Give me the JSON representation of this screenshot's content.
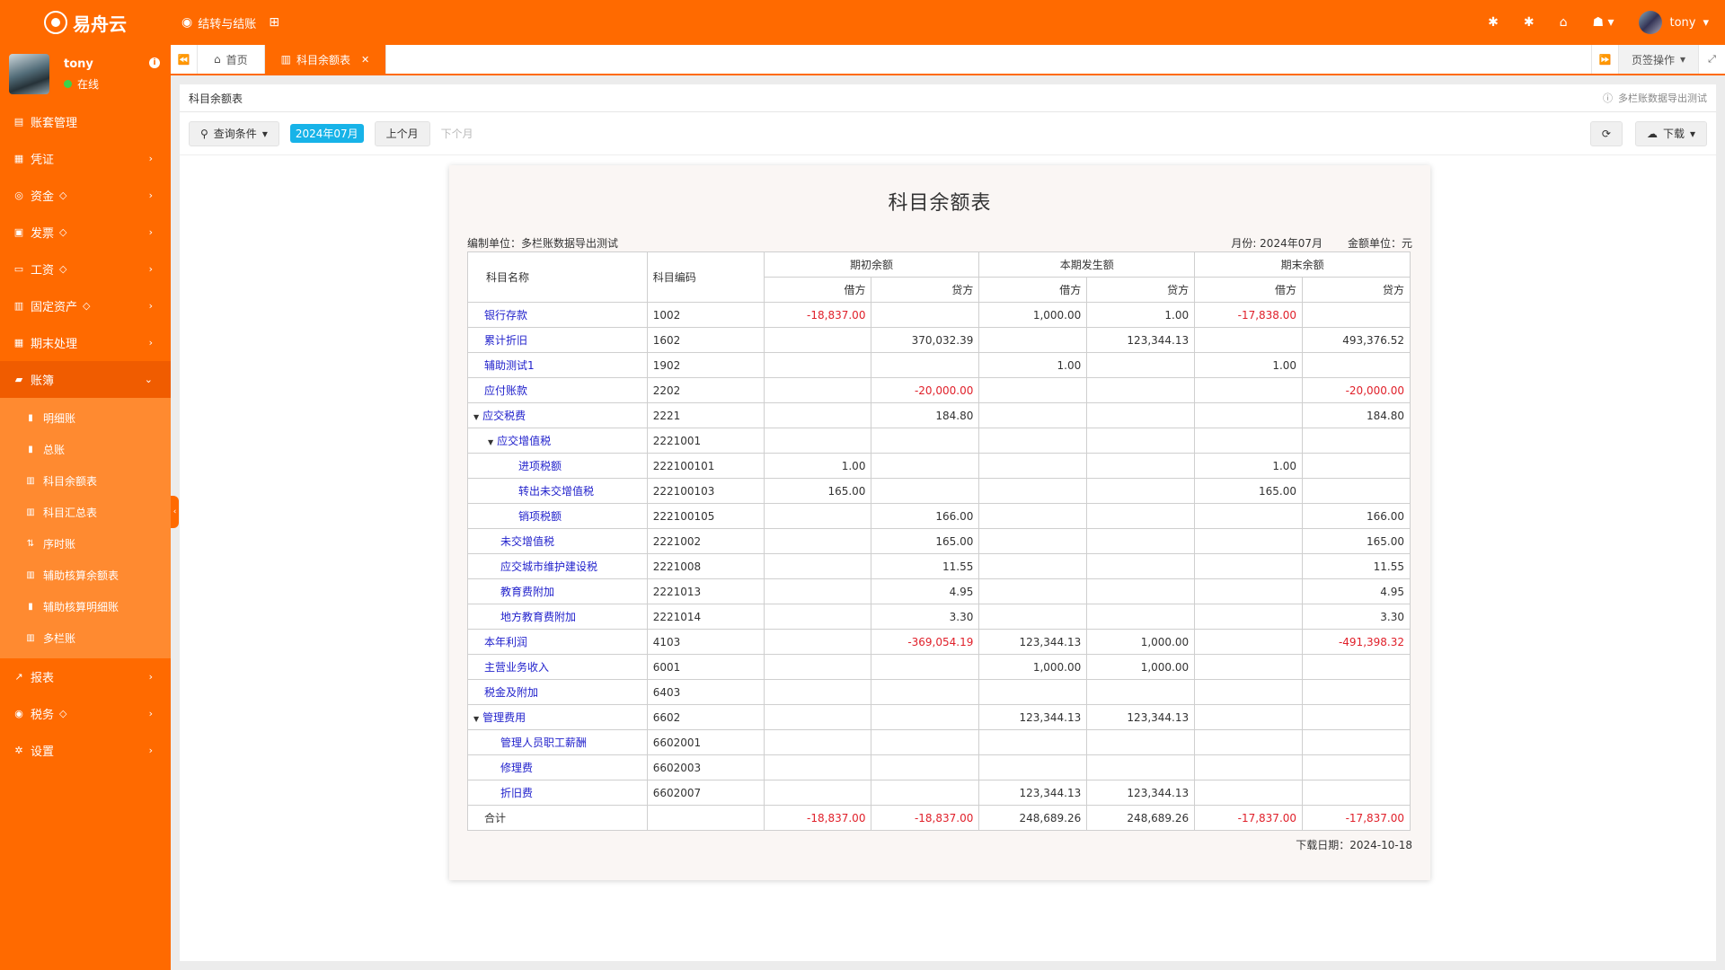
{
  "app": {
    "logo_text": "易舟云",
    "top_tools": [
      "结转与结账"
    ],
    "user": "tony"
  },
  "sidebar": {
    "user": {
      "name": "tony",
      "status": "在线"
    },
    "menu": [
      {
        "label": "账套管理",
        "icon": "book-icon",
        "gem": false,
        "chevron": false
      },
      {
        "label": "凭证",
        "icon": "voucher-icon",
        "gem": false,
        "chevron": true
      },
      {
        "label": "资金",
        "icon": "eye-icon",
        "gem": true,
        "chevron": true
      },
      {
        "label": "发票",
        "icon": "image-icon",
        "gem": true,
        "chevron": true
      },
      {
        "label": "工资",
        "icon": "card-icon",
        "gem": true,
        "chevron": true
      },
      {
        "label": "固定资产",
        "icon": "building-icon",
        "gem": true,
        "chevron": true
      },
      {
        "label": "期末处理",
        "icon": "calendar-icon",
        "gem": false,
        "chevron": true
      },
      {
        "label": "账簿",
        "icon": "ledger-icon",
        "gem": false,
        "chevron": true,
        "active": true
      },
      {
        "label": "报表",
        "icon": "chart-icon",
        "gem": false,
        "chevron": true
      },
      {
        "label": "税务",
        "icon": "tax-icon",
        "gem": true,
        "chevron": true
      },
      {
        "label": "设置",
        "icon": "gear-icon",
        "gem": false,
        "chevron": true
      }
    ],
    "submenu": [
      "明细账",
      "总账",
      "科目余额表",
      "科目汇总表",
      "序时账",
      "辅助核算余额表",
      "辅助核算明细账",
      "多栏账"
    ]
  },
  "tabs": {
    "home": "首页",
    "active": "科目余额表",
    "page_ops": "页签操作"
  },
  "panel": {
    "title": "科目余额表",
    "note": "多栏账数据导出测试"
  },
  "toolbar": {
    "query": "查询条件",
    "period": "2024年07月",
    "prev": "上个月",
    "next": "下个月",
    "download": "下载"
  },
  "report": {
    "title": "科目余额表",
    "unit_label": "编制单位：多栏账数据导出测试",
    "month_label": "月份: 2024年07月",
    "currency_label": "金额单位：元",
    "headers": {
      "name": "科目名称",
      "code": "科目编码",
      "opening": "期初余额",
      "current": "本期发生额",
      "closing": "期末余额",
      "debit": "借方",
      "credit": "贷方"
    },
    "rows": [
      {
        "name": "银行存款",
        "code": "1002",
        "level": 0,
        "toggle": false,
        "v": [
          "-18,837.00",
          "",
          "1,000.00",
          "1.00",
          "-17,838.00",
          ""
        ]
      },
      {
        "name": "累计折旧",
        "code": "1602",
        "level": 0,
        "toggle": false,
        "v": [
          "",
          "370,032.39",
          "",
          "123,344.13",
          "",
          "493,376.52"
        ]
      },
      {
        "name": "辅助测试1",
        "code": "1902",
        "level": 0,
        "toggle": false,
        "v": [
          "",
          "",
          "1.00",
          "",
          "1.00",
          ""
        ]
      },
      {
        "name": "应付账款",
        "code": "2202",
        "level": 0,
        "toggle": false,
        "v": [
          "",
          "-20,000.00",
          "",
          "",
          "",
          "-20,000.00"
        ]
      },
      {
        "name": "应交税费",
        "code": "2221",
        "level": 0,
        "toggle": true,
        "v": [
          "",
          "184.80",
          "",
          "",
          "",
          "184.80"
        ]
      },
      {
        "name": "应交增值税",
        "code": "2221001",
        "level": 1,
        "toggle": true,
        "v": [
          "",
          "",
          "",
          "",
          "",
          ""
        ]
      },
      {
        "name": "进项税额",
        "code": "222100101",
        "level": 2,
        "toggle": false,
        "v": [
          "1.00",
          "",
          "",
          "",
          "1.00",
          ""
        ]
      },
      {
        "name": "转出未交增值税",
        "code": "222100103",
        "level": 2,
        "toggle": false,
        "v": [
          "165.00",
          "",
          "",
          "",
          "165.00",
          ""
        ]
      },
      {
        "name": "销项税额",
        "code": "222100105",
        "level": 2,
        "toggle": false,
        "v": [
          "",
          "166.00",
          "",
          "",
          "",
          "166.00"
        ]
      },
      {
        "name": "未交增值税",
        "code": "2221002",
        "level": 1,
        "toggle": false,
        "v": [
          "",
          "165.00",
          "",
          "",
          "",
          "165.00"
        ]
      },
      {
        "name": "应交城市维护建设税",
        "code": "2221008",
        "level": 1,
        "toggle": false,
        "v": [
          "",
          "11.55",
          "",
          "",
          "",
          "11.55"
        ]
      },
      {
        "name": "教育费附加",
        "code": "2221013",
        "level": 1,
        "toggle": false,
        "v": [
          "",
          "4.95",
          "",
          "",
          "",
          "4.95"
        ]
      },
      {
        "name": "地方教育费附加",
        "code": "2221014",
        "level": 1,
        "toggle": false,
        "v": [
          "",
          "3.30",
          "",
          "",
          "",
          "3.30"
        ]
      },
      {
        "name": "本年利润",
        "code": "4103",
        "level": 0,
        "toggle": false,
        "v": [
          "",
          "-369,054.19",
          "123,344.13",
          "1,000.00",
          "",
          "-491,398.32"
        ]
      },
      {
        "name": "主营业务收入",
        "code": "6001",
        "level": 0,
        "toggle": false,
        "v": [
          "",
          "",
          "1,000.00",
          "1,000.00",
          "",
          ""
        ]
      },
      {
        "name": "税金及附加",
        "code": "6403",
        "level": 0,
        "toggle": false,
        "v": [
          "",
          "",
          "",
          "",
          "",
          ""
        ]
      },
      {
        "name": "管理费用",
        "code": "6602",
        "level": 0,
        "toggle": true,
        "v": [
          "",
          "",
          "123,344.13",
          "123,344.13",
          "",
          ""
        ]
      },
      {
        "name": "管理人员职工薪酬",
        "code": "6602001",
        "level": 1,
        "toggle": false,
        "v": [
          "",
          "",
          "",
          "",
          "",
          ""
        ]
      },
      {
        "name": "修理费",
        "code": "6602003",
        "level": 1,
        "toggle": false,
        "v": [
          "",
          "",
          "",
          "",
          "",
          ""
        ]
      },
      {
        "name": "折旧费",
        "code": "6602007",
        "level": 1,
        "toggle": false,
        "v": [
          "",
          "",
          "123,344.13",
          "123,344.13",
          "",
          ""
        ]
      }
    ],
    "total": {
      "name": "合计",
      "v": [
        "-18,837.00",
        "-18,837.00",
        "248,689.26",
        "248,689.26",
        "-17,837.00",
        "-17,837.00"
      ]
    },
    "download_date": "下载日期：2024-10-18"
  },
  "colors": {
    "brand": "#ff6a00",
    "negative": "#e0202a",
    "link": "#2222cc",
    "period_badge": "#17b3e8"
  }
}
